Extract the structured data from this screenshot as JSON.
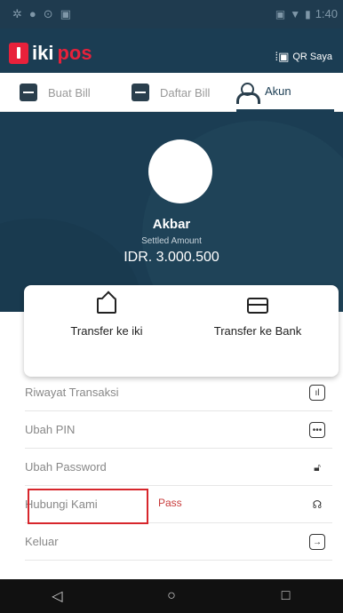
{
  "status_bar": {
    "left_icons": [
      "settings-icon",
      "notification-icon",
      "sync-icon",
      "image-icon"
    ],
    "time": "1:40"
  },
  "app_bar": {
    "logo_part1": "iki",
    "logo_part2": "pos",
    "qr_label": "QR Saya"
  },
  "tabs": [
    {
      "label": "Buat Bill",
      "icon": "bill-icon"
    },
    {
      "label": "Daftar Bill",
      "icon": "bill-icon"
    },
    {
      "label": "Akun",
      "icon": "person-icon"
    }
  ],
  "profile": {
    "name": "Akbar",
    "settled_label": "Settled Amount",
    "settled_amount": "IDR. 3.000.500"
  },
  "transfer": {
    "iki_label": "Transfer ke iki",
    "bank_label": "Transfer ke Bank"
  },
  "menu": [
    {
      "label": "Riwayat Transaksi",
      "icon": "chart-icon"
    },
    {
      "label": "Ubah PIN",
      "icon": "pin-icon"
    },
    {
      "label": "Ubah Password",
      "icon": "lock-icon"
    },
    {
      "label": "Hubungi Kami",
      "icon": "headset-icon"
    },
    {
      "label": "Keluar",
      "icon": "logout-icon"
    }
  ],
  "annotation": {
    "text": "Pass",
    "highlight_color": "#d7262c"
  },
  "nav_bar": [
    "back-icon",
    "home-icon",
    "recents-icon"
  ],
  "colors": {
    "primary": "#1b3d53",
    "brand_red": "#e8213b"
  }
}
